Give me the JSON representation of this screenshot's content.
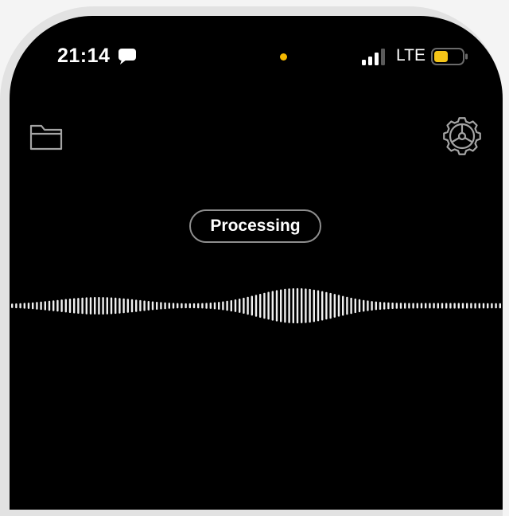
{
  "status_bar": {
    "time": "21:14",
    "network": "LTE",
    "signal_bars_active": 3,
    "signal_bars_total": 4,
    "battery_level": 0.5,
    "battery_color": "#f5c518",
    "privacy_dot_color": "#f5b800"
  },
  "toolbar": {
    "left_icon": "folder-icon",
    "right_icon": "gear-icon"
  },
  "recorder": {
    "status": "Processing"
  },
  "colors": {
    "background": "#000000",
    "foreground": "#ffffff",
    "bezel": "#e2e2e2"
  }
}
